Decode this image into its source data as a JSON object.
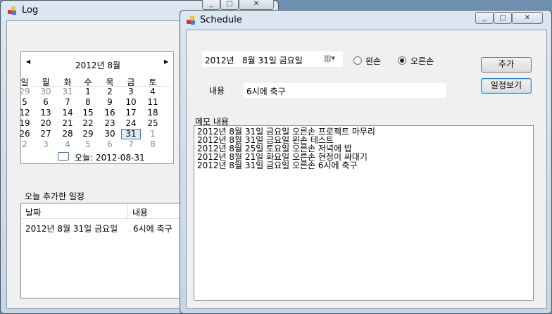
{
  "log_window": {
    "title": "Log",
    "calendar": {
      "month_title": "2012년 8월",
      "weekdays": [
        "일",
        "월",
        "화",
        "수",
        "목",
        "금",
        "토"
      ],
      "weeks": [
        [
          "29",
          "30",
          "31",
          "1",
          "2",
          "3",
          "4"
        ],
        [
          "5",
          "6",
          "7",
          "8",
          "9",
          "10",
          "11"
        ],
        [
          "12",
          "13",
          "14",
          "15",
          "16",
          "17",
          "18"
        ],
        [
          "19",
          "20",
          "21",
          "22",
          "23",
          "24",
          "25"
        ],
        [
          "26",
          "27",
          "28",
          "29",
          "30",
          "31",
          "1"
        ],
        [
          "2",
          "3",
          "4",
          "5",
          "6",
          "7",
          "8"
        ]
      ],
      "selected": "31",
      "today_label": "오늘: 2012-08-31"
    },
    "today_label": "오늘 추가한 일정",
    "list": {
      "headers": [
        "날짜",
        "내용"
      ],
      "rows": [
        [
          "2012년 8월 31일 금요일",
          "6시에 축구"
        ]
      ]
    }
  },
  "schedule_window": {
    "title": "Schedule",
    "date_value": "2012년   8월 31일 금요일",
    "radio_left": "왼손",
    "radio_right": "오른손",
    "radio_selected": "오른손",
    "add_button": "추가",
    "view_button": "일정보기",
    "content_label": "내용",
    "content_value": "6시에 축구",
    "memo_label": "메모 내용",
    "memo_lines": [
      "2012년 8월 31일 금요일 오른손 프로젝트 마무리",
      "2012년 8월 31일 금요일 왼손 테스트",
      "2012년 8월 25일 토요일 오른손 저녁에 밥",
      "2012년 8월 21일 화요일 오른손 현정이 싸대기",
      "2012년 8월 31일 금요일 오른손 6시에 축구"
    ]
  }
}
